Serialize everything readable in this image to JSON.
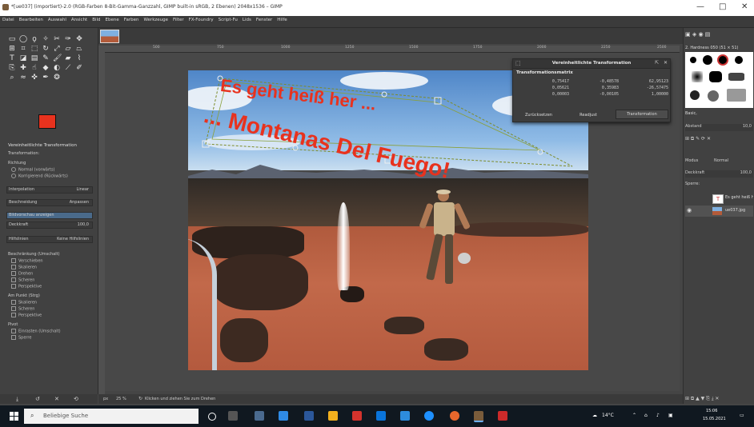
{
  "window": {
    "title": "*[ue037] (importiert)-2.0 (RGB-Farben 8-Bit-Gamma-Ganzzahl, GIMP built-in sRGB, 2 Ebenen) 2048x1536 – GIMP",
    "controls": [
      "—",
      "□",
      "✕"
    ]
  },
  "menubar": {
    "items": [
      "Datei",
      "Bearbeiten",
      "Auswahl",
      "Ansicht",
      "Bild",
      "Ebene",
      "Farben",
      "Werkzeuge",
      "Filter",
      "FX-Foundry",
      "Script-Fu",
      "Lids",
      "Fenster",
      "Hilfe"
    ]
  },
  "toolbox": {
    "tool_icons": [
      "rect-select",
      "ellipse-select",
      "free-select",
      "fuzzy-select",
      "scissors",
      "paths",
      "move",
      "align",
      "crop",
      "unified-transform",
      "rotate",
      "scale",
      "shear",
      "perspective",
      "flip",
      "cage",
      "text",
      "bucket",
      "gradient",
      "pencil",
      "paintbrush",
      "eraser",
      "airbrush",
      "ink",
      "clone",
      "heal",
      "smudge",
      "blur",
      "dodge",
      "measure",
      "color-picker",
      "zoom",
      "warp",
      "handle",
      "3d",
      "mypaint"
    ],
    "fg_color": "#e8321e",
    "bg_color": "#ffffff",
    "options_title": "Vereinheitlichte Transformation",
    "transform_label": "Transformation:",
    "direction_label": "Richtung",
    "direction_options": [
      "Normal (vorwärts)",
      "Korrigierend (Rückwärts)"
    ],
    "interpolation_label": "Interpolation",
    "interpolation_value": "Linear",
    "clipping_label": "Beschneidung",
    "clipping_value": "Anpassen",
    "preview_label": "Bildvorschau anzeigen",
    "opacity_label": "Deckkraft",
    "opacity_value": "100,0",
    "guides_label": "Hilfslinien",
    "guides_value": "Keine Hilfslinien",
    "constrain_label": "Beschränkung (Umschalt)",
    "constrain_options": [
      "Verschieben",
      "Skalieren",
      "Drehen",
      "Scheren",
      "Perspektive"
    ],
    "pivot_label": "Am Punkt (Strg)",
    "pivot_options": [
      "Skalieren",
      "Scheren",
      "Perspektive"
    ],
    "pivot_section": "Pivot",
    "pivot_checks": [
      "Einrasten (Umschalt)",
      "Sperre"
    ]
  },
  "image_tab": {
    "thumb_label": "image-thumbnail"
  },
  "ruler_labels": [
    "500",
    "750",
    "1000",
    "1250",
    "1500",
    "1750",
    "2000",
    "2250",
    "2500"
  ],
  "canvas": {
    "headline_1": "Es geht heiß her ...",
    "headline_2": "... Montanas Del Fuego!"
  },
  "dialog": {
    "title": "Vereinheitlichte Transformation",
    "matrix_title": "Transformationsmatrix",
    "matrix": [
      [
        "0,75417",
        "-0,48578",
        "62,95123"
      ],
      [
        "0,05621",
        "0,35983",
        "-26,57475"
      ],
      [
        "0,00003",
        "-0,00105",
        "1,00000"
      ]
    ],
    "buttons": [
      "Zurücksetzen",
      "Readjust",
      "Transformation"
    ]
  },
  "statusbar": {
    "unit": "px",
    "zoom": "25 %",
    "message": "Klicken und ziehen Sie zum Drehen"
  },
  "rightdock": {
    "brush_name": "2. Hardness 050 (51 × 51)",
    "brush_label": "Basic,",
    "spacing_label": "Abstand",
    "spacing_value": "10,0",
    "mode_label": "Modus",
    "mode_value": "Normal",
    "opacity_label": "Deckkraft",
    "opacity_value": "100,0",
    "lock_label": "Sperre:",
    "layers": [
      {
        "name": "Es geht heiß her ... Montanas Del Fuego!",
        "visible": false
      },
      {
        "name": "ue037.jpg",
        "visible": true
      }
    ]
  },
  "taskbar": {
    "search_placeholder": "Beliebige Suche",
    "temperature": "14°C",
    "time": "15:06",
    "date": "15.05.2021"
  }
}
